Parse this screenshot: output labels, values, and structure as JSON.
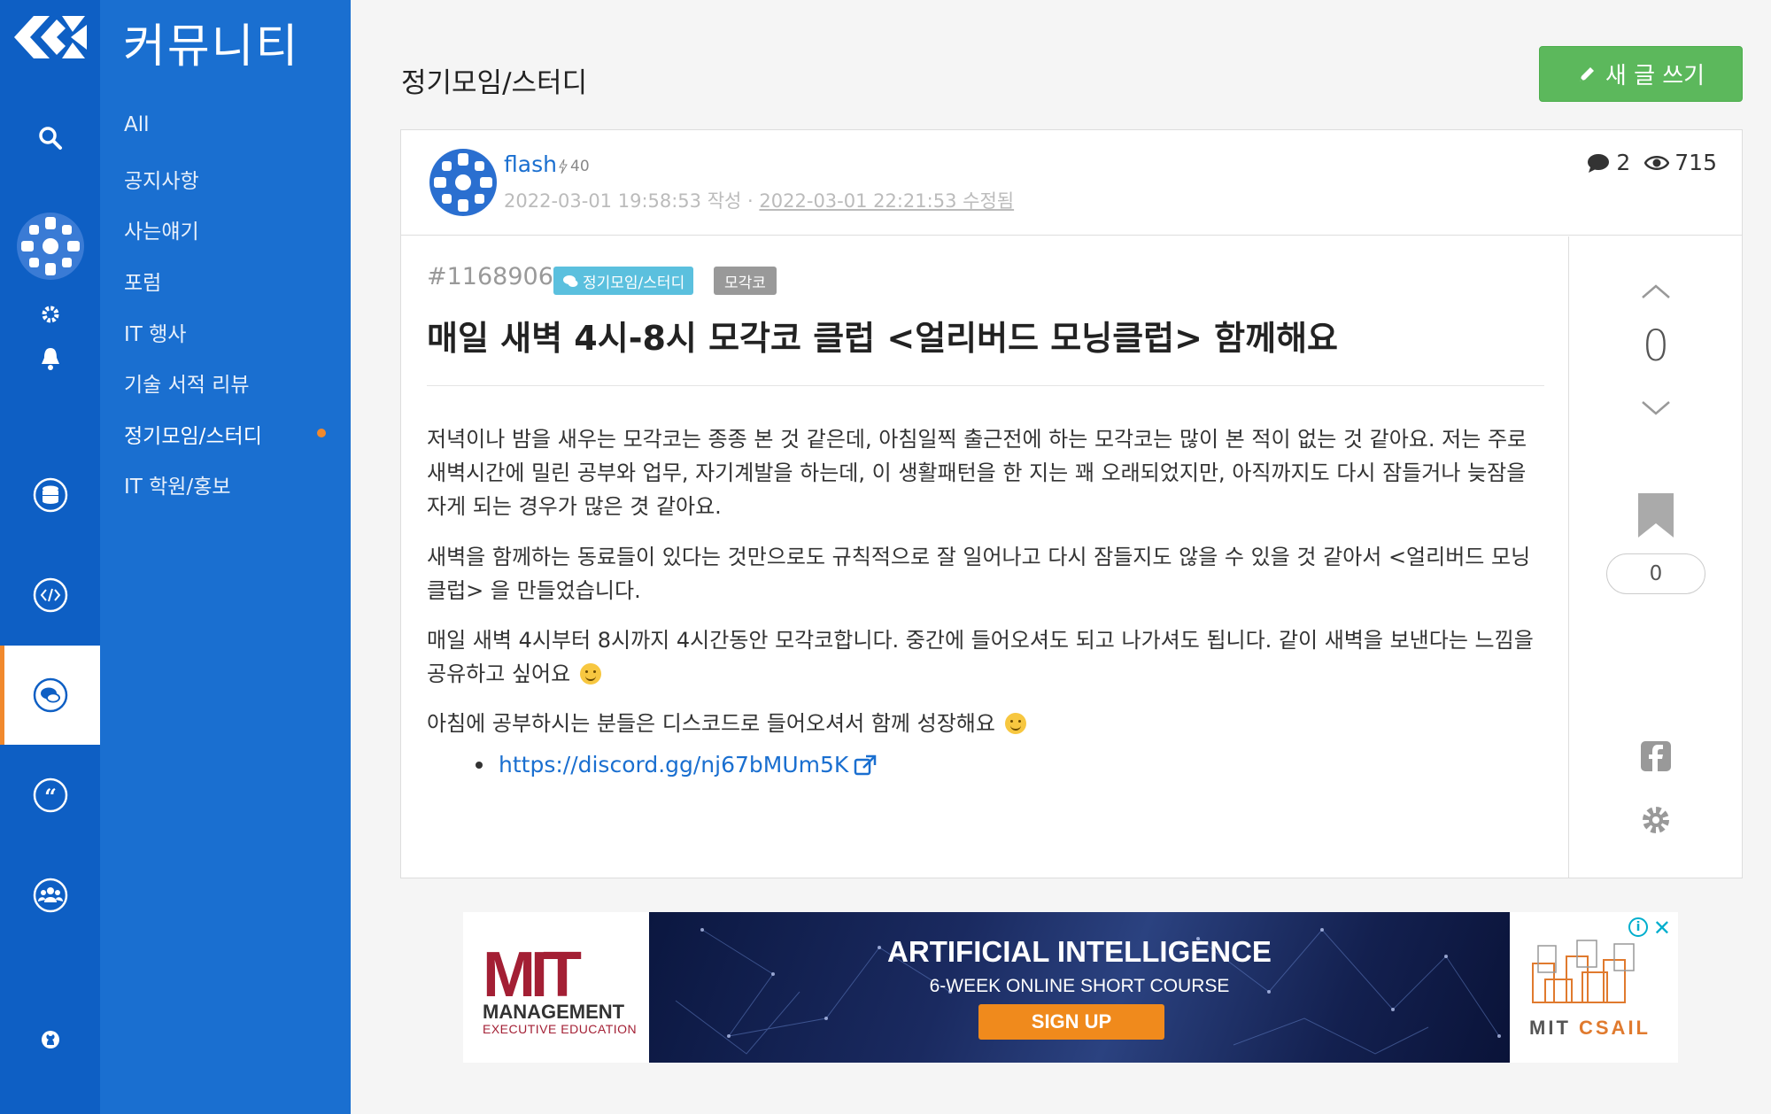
{
  "sidebar": {
    "community_title": "커뮤니티",
    "nav_items": [
      {
        "label": "All"
      },
      {
        "label": "공지사항"
      },
      {
        "label": "사는얘기"
      },
      {
        "label": "포럼"
      },
      {
        "label": "IT 행사"
      },
      {
        "label": "기술 서적 리뷰"
      },
      {
        "label": "정기모임/스터디",
        "active": true
      },
      {
        "label": "IT 학원/홍보"
      }
    ],
    "rail_icons": [
      "logo-icon",
      "search-icon",
      "avatar",
      "gear-icon",
      "bell-icon",
      "database-icon",
      "code-icon",
      "community-icon",
      "quote-icon",
      "users-icon",
      "github-icon"
    ],
    "accent_color": "#f1892d",
    "rail_color": "#0e5fc4",
    "panel_color": "#1a6fd0"
  },
  "main": {
    "page_heading": "정기모임/스터디",
    "new_post_label": "새 글 쓰기",
    "new_post_color": "#5cb85c"
  },
  "post": {
    "author": "flash",
    "author_score": "40",
    "created": "2022-03-01 19:58:53 작성",
    "separator": "·",
    "edited": "2022-03-01 22:21:53 수정됨",
    "comment_count": "2",
    "view_count": "715",
    "number": "#1168906",
    "category_tag": "정기모임/스터디",
    "topic_tag": "모각코",
    "title": "매일 새벽 4시-8시 모각코 클럽 <얼리버드 모닝클럽> 함께해요",
    "paragraphs": [
      {
        "text": "저녁이나 밤을 새우는 모각코는 종종 본 것 같은데, 아침일찍 출근전에 하는 모각코는 많이 본 적이 없는 것 같아요. 저는 주로 새벽시간에 밀린 공부와 업무, 자기계발을 하는데, 이 생활패턴을 한 지는 꽤 오래되었지만, 아직까지도 다시 잠들거나 늦잠을 자게 되는 경우가 많은 겻 같아요."
      },
      {
        "text": "새벽을 함께하는 동료들이 있다는 것만으로도 규칙적으로 잘 일어나고 다시 잠들지도 않을 수 있을 것 같아서 <얼리버드 모닝클럽> 을 만들었습니다."
      },
      {
        "text": "매일 새벽 4시부터 8시까지 4시간동안 모각코합니다. 중간에 들어오셔도 되고 나가셔도 됩니다. 같이 새벽을 보낸다는 느낌을 공유하고 싶어요"
      },
      {
        "text": "아침에 공부하시는 분들은 디스코드로 들어오셔서 함께 성장해요"
      }
    ],
    "link": "https://discord.gg/nj67bMUm5K",
    "vote_count": "0",
    "scrap_count": "0",
    "tag_category_color": "#5bc0de",
    "tag_topic_color": "#999999"
  },
  "ad": {
    "brand_logo": "MIT",
    "brand_line1": "MANAGEMENT",
    "brand_line2": "EXECUTIVE EDUCATION",
    "headline": "ARTIFICIAL INTELLIGENCE",
    "subline": "6-WEEK ONLINE SHORT COURSE",
    "cta": "SIGN UP",
    "right_logo_a": "MIT ",
    "right_logo_b": "CSAIL",
    "info_icon": "i",
    "close_icon": "✕"
  }
}
